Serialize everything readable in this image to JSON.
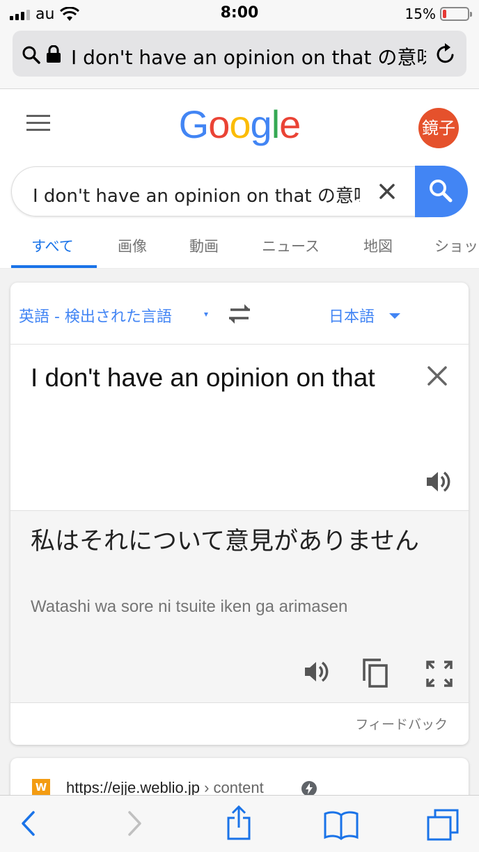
{
  "status_bar": {
    "carrier": "au",
    "time": "8:00",
    "battery_percent": "15%",
    "battery_level": 0.15
  },
  "url_bar": {
    "text": "I don't  have an opinion on that の意味"
  },
  "header": {
    "logo_letters": [
      {
        "char": "G",
        "color": "#4285F4"
      },
      {
        "char": "o",
        "color": "#EA4335"
      },
      {
        "char": "o",
        "color": "#FBBC05"
      },
      {
        "char": "g",
        "color": "#4285F4"
      },
      {
        "char": "l",
        "color": "#34A853"
      },
      {
        "char": "e",
        "color": "#EA4335"
      }
    ],
    "avatar_text": "鏡子",
    "avatar_color": "#E5512C"
  },
  "search": {
    "query": "I don't  have an opinion on that の意味"
  },
  "tabs": [
    {
      "label": "すべて",
      "active": true
    },
    {
      "label": "画像",
      "active": false
    },
    {
      "label": "動画",
      "active": false
    },
    {
      "label": "ニュース",
      "active": false
    },
    {
      "label": "地図",
      "active": false
    },
    {
      "label": "ショッ",
      "active": false
    }
  ],
  "translate": {
    "source_lang": "英語 - 検出された言語",
    "target_lang": "日本語",
    "source_text": "I don't  have an opinion on that",
    "translated_text": "私はそれについて意見がありません",
    "romanization": "Watashi wa sore ni tsuite iken ga arimasen",
    "feedback": "フィードバック"
  },
  "result": {
    "site_icon": "W",
    "url": "https://ejje.weblio.jp",
    "path": " › content"
  },
  "toolbar": {
    "items": [
      "back",
      "forward",
      "share",
      "bookmarks",
      "tabs"
    ]
  },
  "colors": {
    "accent": "#4285F4",
    "link_blue": "#1A73E8"
  }
}
